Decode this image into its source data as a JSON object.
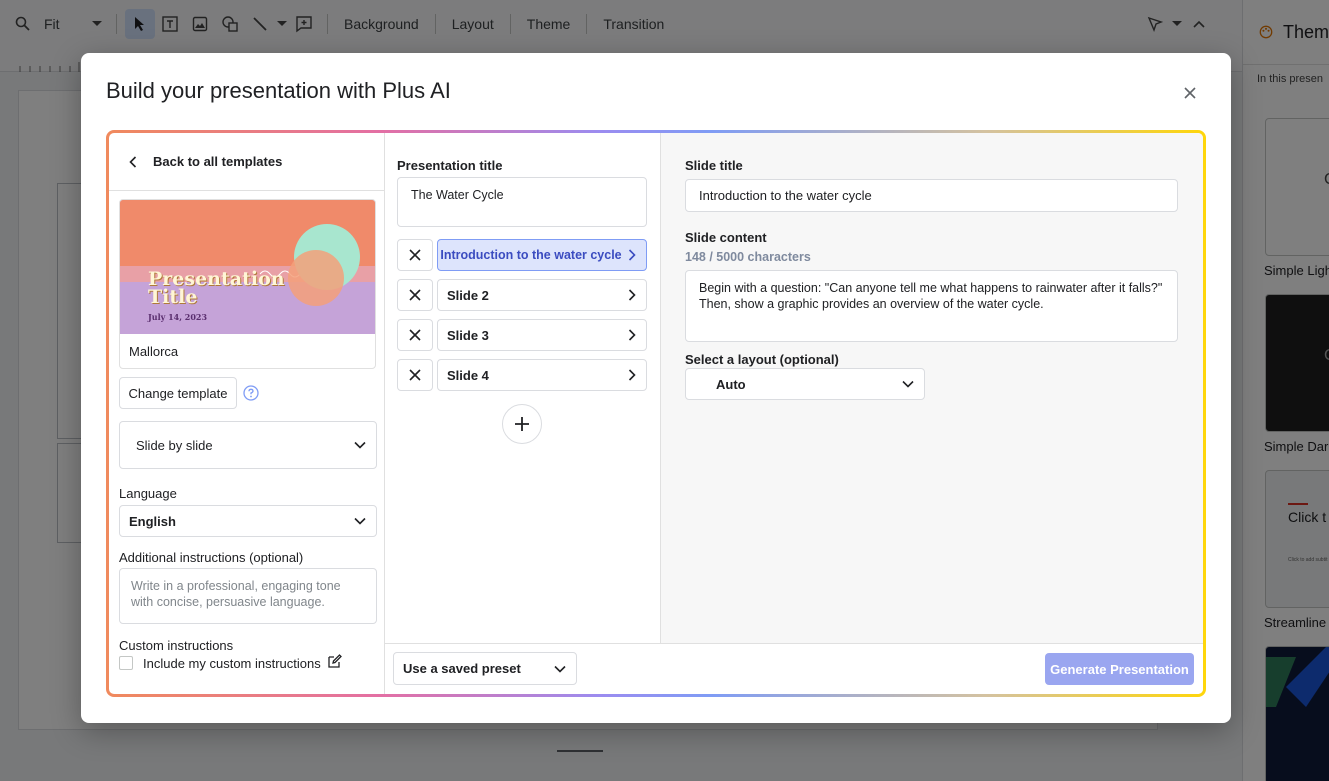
{
  "toolbar": {
    "zoom_value": "Fit",
    "menu_background": "Background",
    "menu_layout": "Layout",
    "menu_theme": "Theme",
    "menu_transition": "Transition"
  },
  "theme_panel": {
    "title": "Them",
    "subtitle": "In this presen",
    "themes": [
      {
        "label": "Simple Ligh",
        "preview_text": "C"
      },
      {
        "label": "Simple Dar",
        "preview_text": "C"
      },
      {
        "label": "Streamline",
        "preview_text": "Click t",
        "preview_subtext": "Click to add subtit"
      }
    ]
  },
  "modal": {
    "title": "Build your presentation with Plus AI",
    "back_label": "Back to all templates",
    "template": {
      "preview_title": "Presentation Title",
      "preview_date": "July 14, 2023",
      "name": "Mallorca"
    },
    "change_template_label": "Change template",
    "mode_select": "Slide by slide",
    "language_label": "Language",
    "language_value": "English",
    "additional_label": "Additional instructions (optional)",
    "additional_placeholder": "Write in a professional, engaging tone with concise, persuasive language.",
    "custom_label": "Custom instructions",
    "custom_checkbox_label": "Include my custom instructions",
    "presentation_title_label": "Presentation title",
    "presentation_title_value": "The Water Cycle",
    "slides": [
      {
        "label": "Introduction to the water cycle"
      },
      {
        "label": "Slide 2"
      },
      {
        "label": "Slide 3"
      },
      {
        "label": "Slide 4"
      }
    ],
    "slide_title_label": "Slide title",
    "slide_title_value": "Introduction to the water cycle",
    "slide_content_label": "Slide content",
    "slide_content_count": "148 / 5000 characters",
    "slide_content_value": "Begin with a question: \"Can anyone tell me what happens to rainwater after it falls?\" Then, show a graphic provides an overview of the water cycle.",
    "layout_label": "Select a layout (optional)",
    "layout_value": "Auto",
    "preset_label": "Use a saved preset",
    "generate_label": "Generate Presentation"
  },
  "colors": {
    "accent": "#7f9cf5",
    "generate_button": "#9aa6f0",
    "active_slide_bg": "#dde4fc"
  }
}
